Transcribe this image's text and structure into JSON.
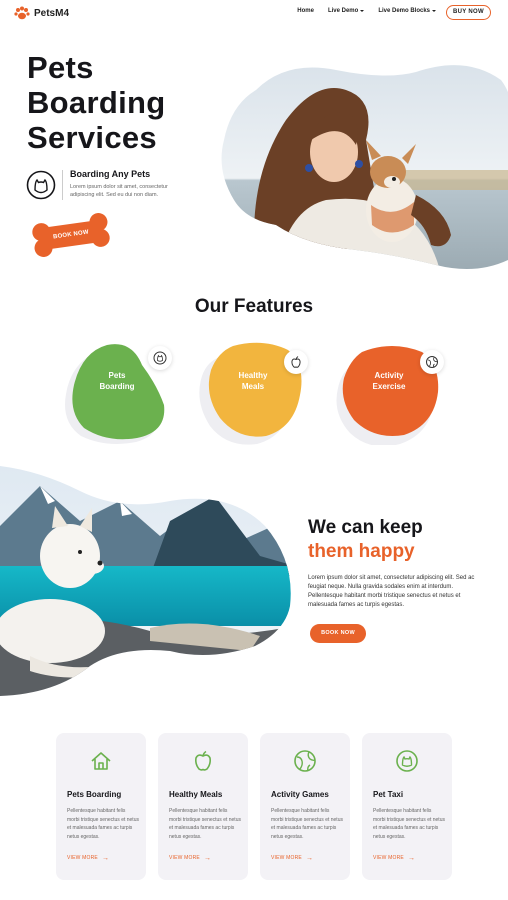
{
  "nav": {
    "brand": "PetsM4",
    "menu": [
      {
        "label": "Home"
      },
      {
        "label": "Live Demo"
      },
      {
        "label": "Live Demo Blocks"
      }
    ],
    "buy_label": "BUY NOW"
  },
  "hero": {
    "title_lines": [
      "Pets",
      "Boarding",
      "Services"
    ],
    "subtitle": "Boarding Any Pets",
    "text": "Lorem ipsum dolor sit amet, consectetur adipiscing elit. Sed eu dui non diam.",
    "button_label": "BOOK NOW"
  },
  "features": {
    "title": "Our Features",
    "items": [
      {
        "label_1": "Pets",
        "label_2": "Boarding",
        "color": "#6bb14e"
      },
      {
        "label_1": "Healthy",
        "label_2": "Meals",
        "color": "#f2b53e"
      },
      {
        "label_1": "Activity",
        "label_2": "Exercise",
        "color": "#e8622a"
      }
    ]
  },
  "happy": {
    "title_line1": "We can keep",
    "title_line2": "them happy",
    "text": "Lorem ipsum dolor sit amet, consectetur adipiscing elit. Sed ac feugiat neque. Nulla gravida sodales enim at interdum. Pellentesque habitant morbi tristique senectus et netus et malesuada fames ac turpis egestas.",
    "button_label": "BOOK NOW"
  },
  "cards": [
    {
      "title": "Pets Boarding",
      "text": "Pellentesque habitant felis morbi tristique senectus et netus et malesuada fames ac turpis netus egestas.",
      "link": "VIEW MORE",
      "icon": "house-icon"
    },
    {
      "title": "Healthy Meals",
      "text": "Pellentesque habitant felis morbi tristique senectus et netus et malesuada fames ac turpis netus egestas.",
      "link": "VIEW MORE",
      "icon": "apple-icon"
    },
    {
      "title": "Activity Games",
      "text": "Pellentesque habitant felis morbi tristique senectus et netus et malesuada fames ac turpis netus egestas.",
      "link": "VIEW MORE",
      "icon": "globe-icon"
    },
    {
      "title": "Pet Taxi",
      "text": "Pellentesque habitant felis morbi tristique senectus et netus et malesuada fames ac turpis netus egestas.",
      "link": "VIEW MORE",
      "icon": "cat-icon"
    }
  ],
  "colors": {
    "accent": "#e8622a",
    "green": "#6bb14e",
    "yellow": "#f2b53e",
    "card_bg": "#f3f2f6"
  }
}
